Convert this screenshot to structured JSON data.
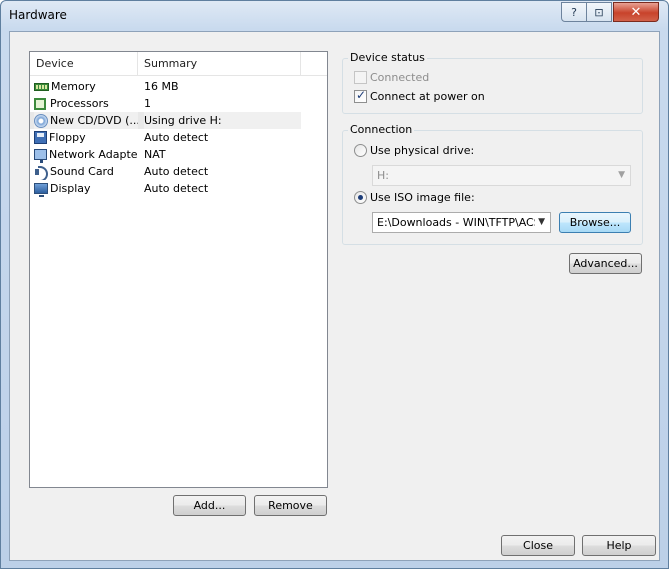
{
  "window": {
    "title": "Hardware",
    "controls": {
      "help": "?",
      "restore": "⊡",
      "close": "✕"
    }
  },
  "device_list": {
    "columns": {
      "device": "Device",
      "summary": "Summary"
    },
    "rows": [
      {
        "device": "Memory",
        "summary": "16 MB",
        "icon": "memory-icon"
      },
      {
        "device": "Processors",
        "summary": "1",
        "icon": "processor-icon"
      },
      {
        "device": "New CD/DVD (...",
        "summary": "Using drive H:",
        "icon": "cd-dvd-icon",
        "selected": true
      },
      {
        "device": "Floppy",
        "summary": "Auto detect",
        "icon": "floppy-icon"
      },
      {
        "device": "Network Adapter",
        "summary": "NAT",
        "icon": "network-adapter-icon"
      },
      {
        "device": "Sound Card",
        "summary": "Auto detect",
        "icon": "sound-card-icon"
      },
      {
        "device": "Display",
        "summary": "Auto detect",
        "icon": "display-icon"
      }
    ],
    "add_label": "Add...",
    "remove_label": "Remove"
  },
  "device_status": {
    "title": "Device status",
    "connected_label": "Connected",
    "connected_checked": false,
    "connect_power_label": "Connect at power on",
    "connect_power_checked": true
  },
  "connection": {
    "title": "Connection",
    "physical_label": "Use physical drive:",
    "physical_value": "H:",
    "iso_label": "Use ISO image file:",
    "iso_value": "E:\\Downloads - WIN\\TFTP\\ACS\\",
    "browse_label": "Browse..."
  },
  "advanced_label": "Advanced...",
  "footer": {
    "close_label": "Close",
    "help_label": "Help"
  }
}
